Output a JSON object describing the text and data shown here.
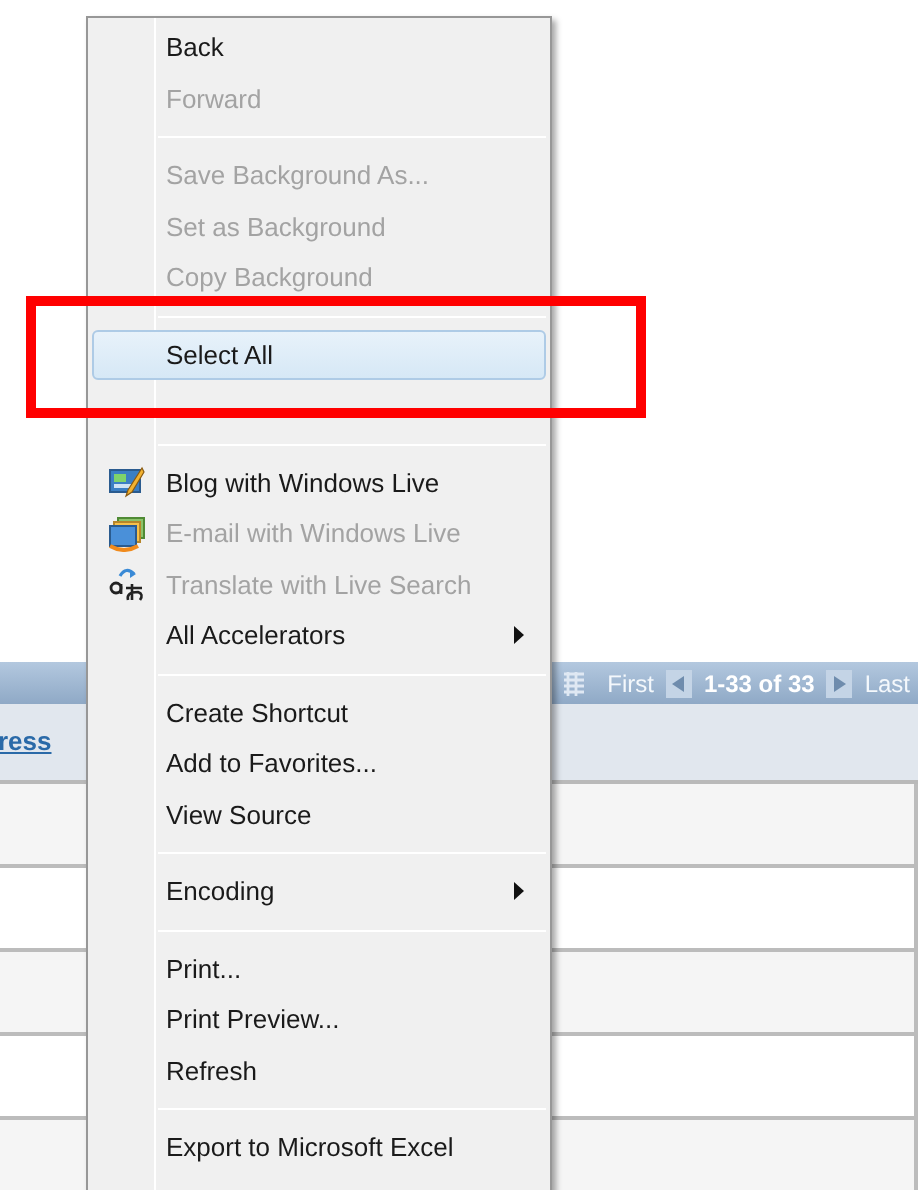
{
  "grid": {
    "pager": {
      "first": "First",
      "range": "1-33 of 33",
      "last": "Last"
    },
    "header_link": "ress"
  },
  "context_menu": {
    "items": [
      {
        "kind": "item",
        "label": "Back",
        "disabled": false,
        "selected": false
      },
      {
        "kind": "item",
        "label": "Forward",
        "disabled": true,
        "selected": false
      },
      {
        "kind": "separator"
      },
      {
        "kind": "item",
        "label": "Save Background As...",
        "disabled": true,
        "selected": false
      },
      {
        "kind": "item",
        "label": "Set as Background",
        "disabled": true,
        "selected": false
      },
      {
        "kind": "item",
        "label": "Copy Background",
        "disabled": true,
        "selected": false
      },
      {
        "kind": "separator"
      },
      {
        "kind": "item",
        "label": "Select All",
        "disabled": false,
        "selected": true
      },
      {
        "kind": "covered-item"
      },
      {
        "kind": "separator"
      },
      {
        "kind": "item",
        "label": "Blog with Windows Live",
        "disabled": false,
        "selected": false
      },
      {
        "kind": "item",
        "label": "E-mail with Windows Live",
        "disabled": true,
        "selected": false
      },
      {
        "kind": "item",
        "label": "Translate with Live Search",
        "disabled": true,
        "selected": false
      },
      {
        "kind": "item",
        "label": "All Accelerators",
        "disabled": false,
        "selected": false,
        "submenu": true
      },
      {
        "kind": "separator"
      },
      {
        "kind": "item",
        "label": "Create Shortcut",
        "disabled": false,
        "selected": false
      },
      {
        "kind": "item",
        "label": "Add to Favorites...",
        "disabled": false,
        "selected": false
      },
      {
        "kind": "item",
        "label": "View Source",
        "disabled": false,
        "selected": false
      },
      {
        "kind": "separator"
      },
      {
        "kind": "item",
        "label": "Encoding",
        "disabled": false,
        "selected": false,
        "submenu": true
      },
      {
        "kind": "separator"
      },
      {
        "kind": "item",
        "label": "Print...",
        "disabled": false,
        "selected": false
      },
      {
        "kind": "item",
        "label": "Print Preview...",
        "disabled": false,
        "selected": false
      },
      {
        "kind": "item",
        "label": "Refresh",
        "disabled": false,
        "selected": false
      },
      {
        "kind": "separator"
      },
      {
        "kind": "item",
        "label": "Export to Microsoft Excel",
        "disabled": false,
        "selected": false
      }
    ]
  },
  "annotation": {
    "kind": "highlight-box"
  }
}
